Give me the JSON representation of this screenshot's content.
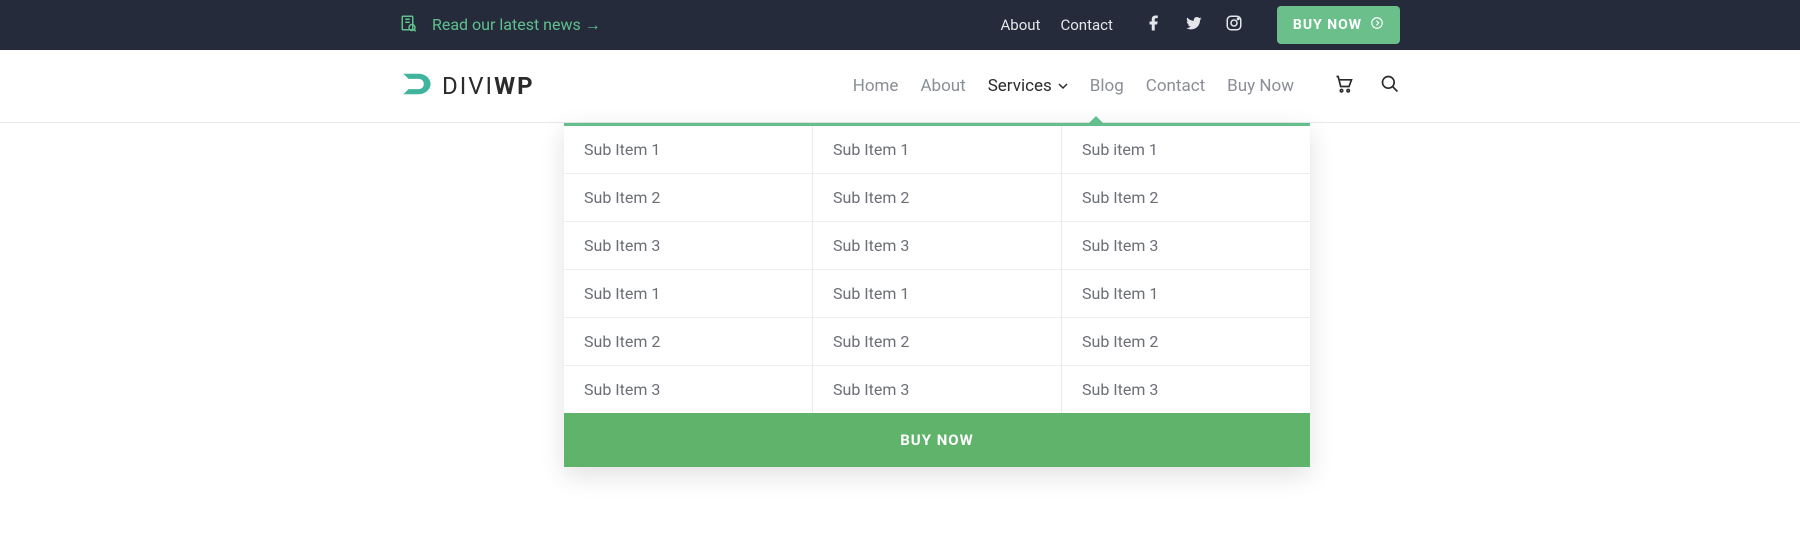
{
  "topbar": {
    "news_label": "Read our latest news →",
    "links": [
      {
        "label": "About"
      },
      {
        "label": "Contact"
      }
    ],
    "buy_label": "BUY NOW"
  },
  "logo": {
    "divi": "DIVI",
    "wp": "WP"
  },
  "nav": {
    "items": [
      {
        "label": "Home"
      },
      {
        "label": "About"
      },
      {
        "label": "Services"
      },
      {
        "label": "Blog"
      },
      {
        "label": "Contact"
      },
      {
        "label": "Buy Now"
      }
    ]
  },
  "mega": {
    "columns": [
      [
        "Sub Item 1",
        "Sub Item 2",
        "Sub Item 3",
        "Sub Item 1",
        "Sub Item 2",
        "Sub Item 3"
      ],
      [
        "Sub Item 1",
        "Sub Item 2",
        "Sub Item 3",
        "Sub Item 1",
        "Sub Item 2",
        "Sub Item 3"
      ],
      [
        "Sub item 1",
        "Sub Item 2",
        "Sub Item 3",
        "Sub Item 1",
        "Sub Item 2",
        "Sub Item 3"
      ]
    ],
    "buy_label": "BUY NOW"
  }
}
